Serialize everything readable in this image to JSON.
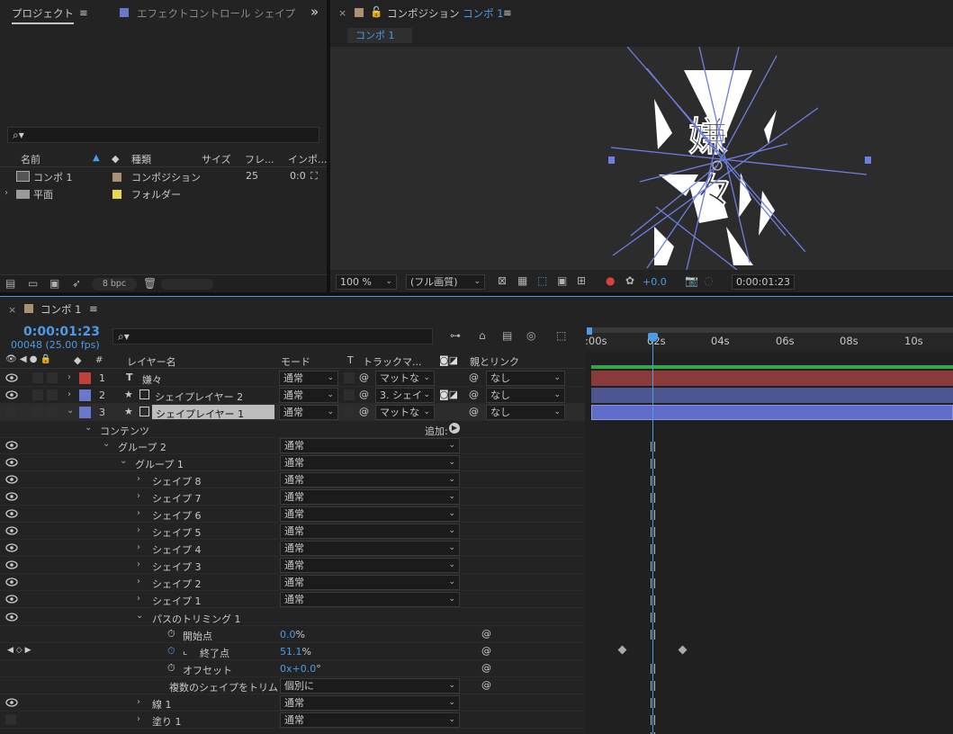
{
  "project_panel": {
    "tab_label": "プロジェクト",
    "menu": "≡",
    "effect_tab_label": "エフェクトコントロール シェイプ",
    "overflow": "»",
    "search_placeholder": "",
    "columns": {
      "name": "名前",
      "type": "種類",
      "size": "サイズ",
      "fps": "フレ...",
      "in": "インポ..."
    },
    "items": [
      {
        "name": "コンポ 1",
        "type": "コンポジション",
        "fps": "25",
        "in": "0:0"
      },
      {
        "name": "平面",
        "type": "フォルダー"
      }
    ],
    "bpc": "8 bpc"
  },
  "comp_panel": {
    "close": "×",
    "title_prefix": "コンポジション",
    "title_comp": "コンポ 1",
    "menu": "≡",
    "subtab": "コンポ 1",
    "zoom": "100 %",
    "quality": "(フル画質)",
    "exposure": "+0.0",
    "timecode": "0:00:01:23",
    "glyph_top": "嫌",
    "glyph_bottom": "々"
  },
  "timeline": {
    "close": "×",
    "comp_name": "コンポ 1",
    "menu": "≡",
    "timecode": "0:00:01:23",
    "frame_info": "00048 (25.00 fps)",
    "headers": {
      "num": "#",
      "layer_name": "レイヤー名",
      "mode": "モード",
      "t": "T",
      "track_matte": "トラックマ...",
      "parent": "親とリンク"
    },
    "ruler": {
      "t0": ":00s",
      "t1": "02s",
      "t2": "04s",
      "t3": "06s",
      "t4": "08s",
      "t5": "10s"
    },
    "layers": [
      {
        "index": "1",
        "name": "嫌々",
        "type_icon": "T",
        "mode": "通常",
        "matte": "マットな",
        "parent": "なし",
        "color": "#c0403d"
      },
      {
        "index": "2",
        "name": "シェイプレイヤー 2",
        "type_icon": "★",
        "mode": "通常",
        "matte": "3. シェイ",
        "parent": "なし",
        "color": "#6a78cc"
      },
      {
        "index": "3",
        "name": "シェイプレイヤー 1",
        "type_icon": "★",
        "mode": "通常",
        "matte": "マットな",
        "parent": "なし",
        "color": "#6a78cc"
      }
    ],
    "contents_label": "コンテンツ",
    "add_label": "追加:",
    "groups": [
      {
        "name": "グループ 2",
        "mode": "通常"
      },
      {
        "name": "グループ 1",
        "mode": "通常"
      },
      {
        "name": "シェイプ 8",
        "mode": "通常"
      },
      {
        "name": "シェイプ 7",
        "mode": "通常"
      },
      {
        "name": "シェイプ 6",
        "mode": "通常"
      },
      {
        "name": "シェイプ 5",
        "mode": "通常"
      },
      {
        "name": "シェイプ 4",
        "mode": "通常"
      },
      {
        "name": "シェイプ 3",
        "mode": "通常"
      },
      {
        "name": "シェイプ 2",
        "mode": "通常"
      },
      {
        "name": "シェイプ 1",
        "mode": "通常"
      }
    ],
    "trim": {
      "name": "パスのトリミング 1",
      "start_label": "開始点",
      "start_value": "0.0",
      "start_unit": "%",
      "end_label": "終了点",
      "end_value": "51.1",
      "end_unit": "%",
      "offset_label": "オフセット",
      "offset_value": "0x+0.0",
      "offset_unit": "°",
      "multi_label": "複数のシェイプをトリム",
      "multi_value": "個別に"
    },
    "stroke": {
      "name": "線 1",
      "mode": "通常"
    },
    "fill": {
      "name": "塗り 1",
      "mode": "通常"
    }
  },
  "colors": {
    "accent": "#4d9ae6",
    "red": "#c0403d",
    "blue": "#6a78cc",
    "yellow": "#e6d84a",
    "tan": "#a89174"
  }
}
